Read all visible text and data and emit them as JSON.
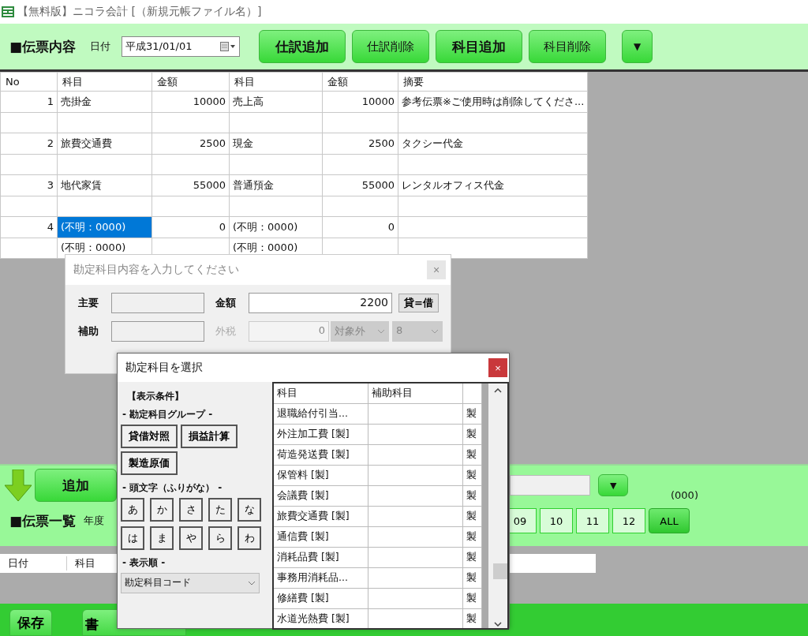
{
  "window": {
    "title": "【無料版】ニコラ会計 [（新規元帳ファイル名）]"
  },
  "header": {
    "title": "■伝票内容",
    "date_label": "日付",
    "date_value": "平成31/01/01",
    "buttons": [
      {
        "label": "仕訳追加",
        "bold": true
      },
      {
        "label": "仕訳削除",
        "bold": false
      },
      {
        "label": "科目追加",
        "bold": true
      },
      {
        "label": "科目削除",
        "bold": false
      }
    ],
    "menu_button": "▼"
  },
  "journal": {
    "columns": [
      "No",
      "科目",
      "金額",
      "科目",
      "金額",
      "摘要"
    ],
    "rows": [
      {
        "cells": [
          {
            "text": "1",
            "selected": false
          },
          {
            "text": "売掛金",
            "selected": false
          },
          {
            "text": "10000",
            "selected": false
          },
          {
            "text": "売上高",
            "selected": false
          },
          {
            "text": "10000",
            "selected": false
          },
          {
            "text": "参考伝票※ご使用時は削除してくださ...",
            "selected": false
          }
        ]
      },
      {
        "cells": [
          {
            "selected": false
          },
          {
            "selected": false
          },
          {
            "selected": false
          },
          {
            "selected": false
          },
          {
            "selected": false
          },
          {
            "selected": false
          }
        ]
      },
      {
        "cells": [
          {
            "text": "2",
            "selected": false
          },
          {
            "text": "旅費交通費",
            "selected": false
          },
          {
            "text": "2500",
            "selected": false
          },
          {
            "text": "現金",
            "selected": false
          },
          {
            "text": "2500",
            "selected": false
          },
          {
            "text": "タクシー代金",
            "selected": false
          }
        ]
      },
      {
        "cells": [
          {
            "selected": false
          },
          {
            "selected": false
          },
          {
            "selected": false
          },
          {
            "selected": false
          },
          {
            "selected": false
          },
          {
            "selected": false
          }
        ]
      },
      {
        "cells": [
          {
            "text": "3",
            "selected": false
          },
          {
            "text": "地代家賃",
            "selected": false
          },
          {
            "text": "55000",
            "selected": false
          },
          {
            "text": "普通預金",
            "selected": false
          },
          {
            "text": "55000",
            "selected": false
          },
          {
            "text": "レンタルオフィス代金",
            "selected": false
          }
        ]
      },
      {
        "cells": [
          {
            "selected": false
          },
          {
            "selected": false
          },
          {
            "selected": false
          },
          {
            "selected": false
          },
          {
            "selected": false
          },
          {
            "selected": false
          }
        ]
      },
      {
        "cells": [
          {
            "text": "4",
            "selected": false
          },
          {
            "text": "(不明：0000)",
            "selected": true
          },
          {
            "text": "0",
            "selected": false
          },
          {
            "text": "(不明：0000)",
            "selected": false
          },
          {
            "text": "0",
            "selected": false
          },
          {
            "selected": false
          }
        ]
      },
      {
        "cells": [
          {
            "selected": false
          },
          {
            "text": "(不明：0000)",
            "selected": false
          },
          {
            "selected": false
          },
          {
            "text": "(不明：0000)",
            "selected": false
          },
          {
            "selected": false
          },
          {
            "selected": false
          }
        ]
      }
    ]
  },
  "entry_bar": {
    "add_button": "追加",
    "dropdown_button": "▼",
    "count": "(000)"
  },
  "voucher_list": {
    "title": "■伝票一覧",
    "year_label": "年度",
    "months": [
      {
        "label": "09",
        "selected": false
      },
      {
        "label": "10",
        "selected": false
      },
      {
        "label": "11",
        "selected": false
      },
      {
        "label": "12",
        "selected": false
      },
      {
        "label": "ALL",
        "selected": true
      }
    ],
    "columns": [
      "日付",
      "科目"
    ]
  },
  "footer": {
    "buttons": [
      "保存",
      "書"
    ]
  },
  "entry_dialog": {
    "title": "勘定科目内容を入力してください",
    "close": "×",
    "main_label": "主要",
    "amount_label": "金額",
    "amount_value": "2200",
    "balance_button": "貸=借",
    "sub_label": "補助",
    "tax_label": "外税",
    "tax_value": "0",
    "tax_type": "対象外",
    "tax_rate": "8",
    "tax_disabled": true
  },
  "select_dialog": {
    "title": "勘定科目を選択",
    "close": "×",
    "conditions_title": "【表示条件】",
    "group_label": "- 勘定科目グループ -",
    "group_buttons": [
      "貸借対照",
      "損益計算",
      "製造原価"
    ],
    "initial_label": "- 頭文字（ふりがな） -",
    "kana_buttons": [
      "あ",
      "か",
      "さ",
      "た",
      "な",
      "は",
      "ま",
      "や",
      "ら",
      "わ"
    ],
    "order_label": "- 表示順 -",
    "order_value": "勘定科目コード",
    "columns": [
      "科目",
      "補助科目"
    ],
    "rows": [
      {
        "account": "退職給付引当...",
        "mark": "製"
      },
      {
        "account": "外注加工費 [製]",
        "mark": "製"
      },
      {
        "account": "荷造発送費 [製]",
        "mark": "製"
      },
      {
        "account": "保管料 [製]",
        "mark": "製"
      },
      {
        "account": "会議費 [製]",
        "mark": "製"
      },
      {
        "account": "旅費交通費 [製]",
        "mark": "製"
      },
      {
        "account": "通信費 [製]",
        "mark": "製"
      },
      {
        "account": "消耗品費 [製]",
        "mark": "製"
      },
      {
        "account": "事務用消耗品...",
        "mark": "製"
      },
      {
        "account": "修繕費 [製]",
        "mark": "製"
      },
      {
        "account": "水道光熱費 [製]",
        "mark": "製"
      }
    ]
  }
}
